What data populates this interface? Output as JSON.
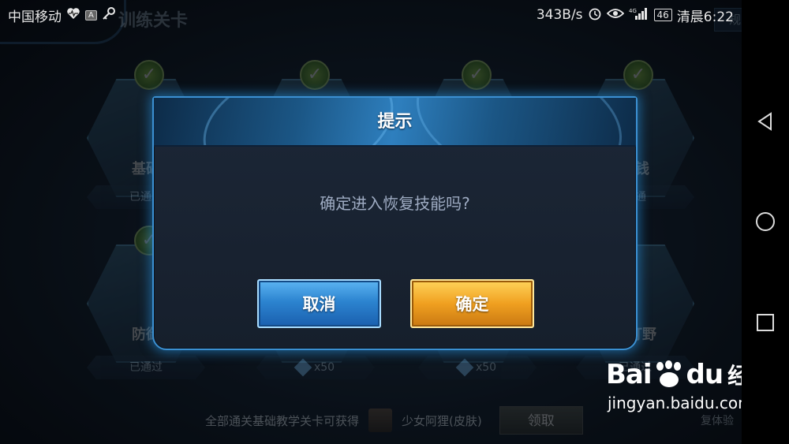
{
  "status_bar": {
    "carrier": "中国移动",
    "net_speed": "343B/s",
    "battery": "46",
    "time": "清晨6:22",
    "icons": [
      "heart-icon",
      "a-icon",
      "key-icon",
      "alarm-icon",
      "eye-icon",
      "signal-icon"
    ]
  },
  "header": {
    "title": "训练关卡",
    "rules_label": "规则"
  },
  "levels": [
    {
      "name": "基础",
      "status": "已通过"
    },
    {
      "name": "",
      "status": ""
    },
    {
      "name": "",
      "status": ""
    },
    {
      "name": "金钱",
      "status": "已通"
    },
    {
      "name": "防御",
      "status": "已通过"
    },
    {
      "name": "",
      "reward": "x50"
    },
    {
      "name": "",
      "reward": "x50"
    },
    {
      "name": "谷打野",
      "status": "已通过"
    }
  ],
  "bottom": {
    "text": "全部通关基础教学关卡可获得",
    "skin_name": "少女阿狸(皮肤)",
    "claim_label": "领取",
    "extra_text": "复体验"
  },
  "dialog": {
    "title": "提示",
    "message": "确定进入恢复技能吗?",
    "cancel_label": "取消",
    "confirm_label": "确定"
  },
  "watermark": {
    "brand_left": "Bai",
    "brand_right": "du",
    "brand_cn": "经验",
    "url": "jingyan.baidu.com"
  },
  "colors": {
    "dialog_border": "#3b8fd1",
    "cancel_button": "#2c84d0",
    "confirm_button": "#f0a020",
    "message_text": "#9eabc2"
  }
}
